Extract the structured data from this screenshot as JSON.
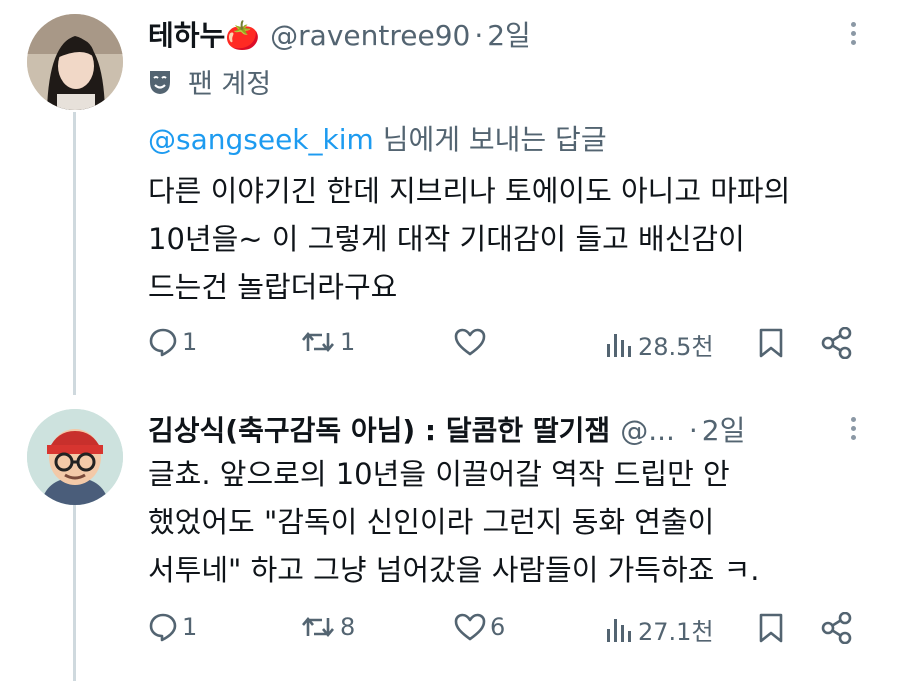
{
  "colors": {
    "accent": "#1d9bf0",
    "text": "#0f1419",
    "muted": "#536471",
    "thread_line": "#cfd9de"
  },
  "tweets": [
    {
      "name": "테하누🍅",
      "handle": "@raventree90",
      "time": "2일",
      "badge_icon": "theater-mask-icon",
      "badge_label": "팬 계정",
      "reply_prefix_mention": "@sangseek_kim",
      "reply_suffix": " 님에게 보내는 답글",
      "body_lines": [
        "다른 이야기긴 한데 지브리나 토에이도 아니고 마파의",
        "10년을~ 이 그렇게 대작 기대감이 들고 배신감이",
        "드는건 놀랍더라구요"
      ],
      "actions": {
        "replies": "1",
        "reposts": "1",
        "likes": "",
        "views": "28.5천"
      }
    },
    {
      "name": "김상식(축구감독 아님) : 달콤한 딸기잼",
      "handle": "@...",
      "time": "2일",
      "body_lines": [
        "글쵸. 앞으로의 10년을 이끌어갈 역작 드립만 안",
        "했었어도 \"감독이 신인이라 그런지 동화 연출이",
        "서투네\" 하고 그냥 넘어갔을 사람들이 가득하죠 ㅋ."
      ],
      "actions": {
        "replies": "1",
        "reposts": "8",
        "likes": "6",
        "views": "27.1천"
      }
    }
  ]
}
